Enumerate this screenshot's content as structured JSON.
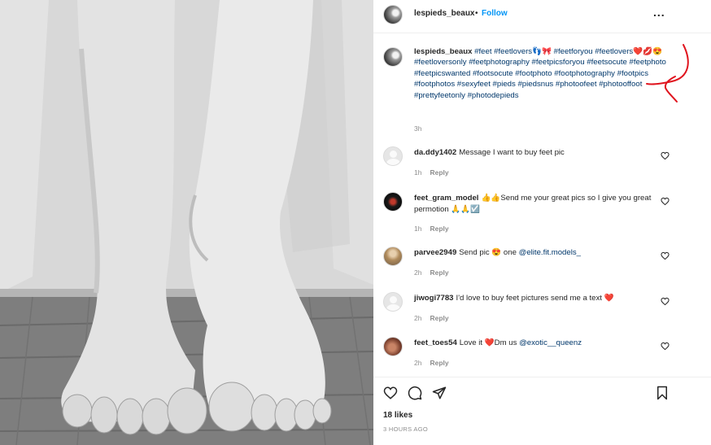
{
  "header": {
    "username": "lespieds_beaux",
    "separator": "•",
    "follow_label": "Follow",
    "more_label": "..."
  },
  "caption": {
    "username": "lespieds_beaux",
    "text": "#feet #feetlovers👣🎀 #feetforyou #feetlovers❤️💋😍 #feetloversonly #feetphotography #feetpicsforyou #feetsocute #feetphoto #feetpicswanted #footsocute #footphoto #footphotography #footpics #footphotos #sexyfeet #pieds #piedsnus #photoofeet #photooffoot #prettyfeetonly #photodepieds",
    "time": "3h"
  },
  "comments": [
    {
      "username": "da.ddy1402",
      "text": "Message I want to buy feet pic",
      "mention": "",
      "time": "1h",
      "reply": "Reply",
      "avatar": "blank"
    },
    {
      "username": "feet_gram_model",
      "text": "👍👍Send me your great pics so I give you great permotion 🙏🙏☑️",
      "mention": "",
      "time": "1h",
      "reply": "Reply",
      "avatar": "dark"
    },
    {
      "username": "parvee2949",
      "text": "Send pic 😍 one ",
      "mention": "@elite.fit.models_",
      "time": "2h",
      "reply": "Reply",
      "avatar": "blonde"
    },
    {
      "username": "jiwogi7783",
      "text": "I'd love to buy feet pictures send me a text ❤️",
      "mention": "",
      "time": "2h",
      "reply": "Reply",
      "avatar": "blank"
    },
    {
      "username": "feet_toes54",
      "text": "Love it ❤️Dm us ",
      "mention": "@exotic__queenz",
      "time": "2h",
      "reply": "Reply",
      "avatar": "skin"
    }
  ],
  "footer": {
    "likes": "18 likes",
    "posted_ago": "3 HOURS AGO"
  },
  "icons": {
    "like": "heart-outline-icon",
    "comment": "comment-bubble-icon",
    "share": "paper-plane-icon",
    "save": "bookmark-icon",
    "more": "more-dots-icon"
  },
  "colors": {
    "link": "#0095f6",
    "hashtag": "#00376b",
    "annotation": "#e0141e",
    "muted": "#8e8e8e"
  }
}
